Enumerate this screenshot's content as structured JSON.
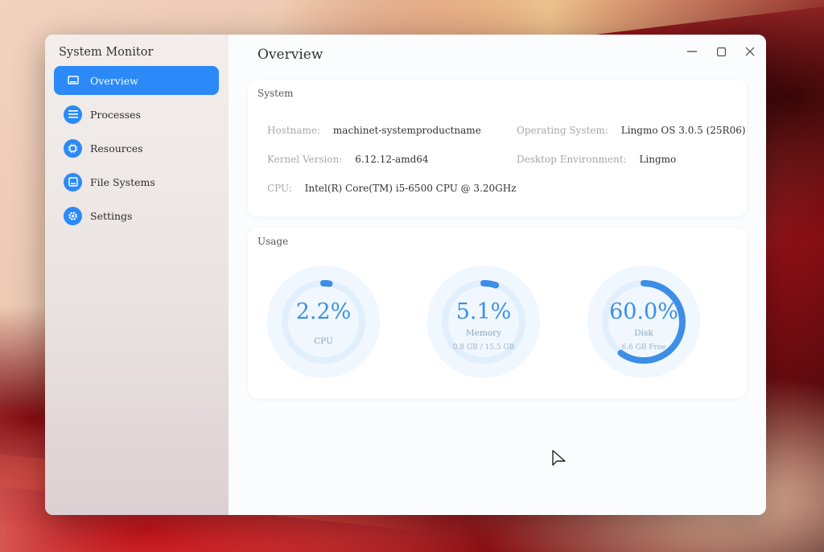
{
  "app": {
    "title": "System Monitor"
  },
  "sidebar": {
    "items": [
      {
        "label": "Overview",
        "icon": "monitor-icon",
        "active": true
      },
      {
        "label": "Processes",
        "icon": "list-icon",
        "active": false
      },
      {
        "label": "Resources",
        "icon": "chip-icon",
        "active": false
      },
      {
        "label": "File Systems",
        "icon": "drive-icon",
        "active": false
      },
      {
        "label": "Settings",
        "icon": "gear-icon",
        "active": false
      }
    ]
  },
  "main": {
    "title": "Overview",
    "system": {
      "title": "System",
      "hostname_label": "Hostname:",
      "hostname": "machinet-systemproductname",
      "os_label": "Operating System:",
      "os": "Lingmo OS 3.0.5 (25R06)",
      "kernel_label": "Kernel Version:",
      "kernel": "6.12.12-amd64",
      "desktop_label": "Desktop Environment:",
      "desktop": "Lingmo",
      "cpu_label": "CPU:",
      "cpu": "Intel(R) Core(TM) i5-6500 CPU @ 3.20GHz"
    },
    "usage": {
      "title": "Usage",
      "gauges": [
        {
          "name": "cpu",
          "value": "2.2%",
          "fraction": 0.022,
          "label": "CPU",
          "sub": ""
        },
        {
          "name": "memory",
          "value": "5.1%",
          "fraction": 0.051,
          "label": "Memory",
          "sub": "0.8 GB / 15.5 GB"
        },
        {
          "name": "disk",
          "value": "60.0%",
          "fraction": 0.6,
          "label": "Disk",
          "sub": "6.6 GB Free"
        }
      ]
    }
  },
  "colors": {
    "accent": "#2b8af7",
    "gauge_track": "#e1effc",
    "gauge_fill": "#3d8ee6"
  }
}
